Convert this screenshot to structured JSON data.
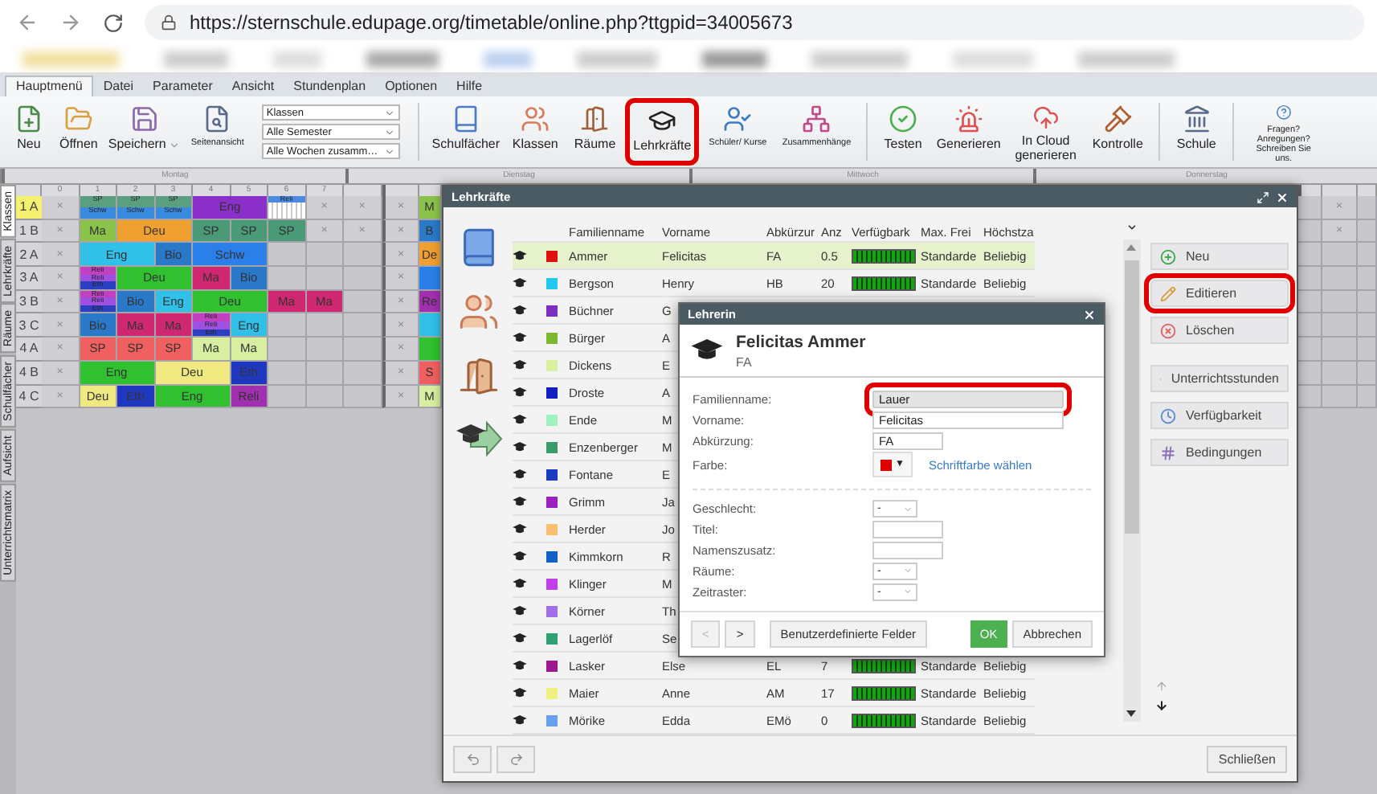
{
  "browser": {
    "url": "https://sternschule.edupage.org/timetable/online.php?ttgpid=34005673"
  },
  "menu_tabs": [
    {
      "label": "Hauptmenü",
      "selected": true
    },
    {
      "label": "Datei",
      "selected": false
    },
    {
      "label": "Parameter",
      "selected": false
    },
    {
      "label": "Ansicht",
      "selected": false
    },
    {
      "label": "Stundenplan",
      "selected": false
    },
    {
      "label": "Optionen",
      "selected": false
    },
    {
      "label": "Hilfe",
      "selected": false
    }
  ],
  "toolbar": [
    {
      "kind": "button",
      "label": "Neu",
      "highlighted": false
    },
    {
      "kind": "button",
      "label": "Öffnen",
      "highlighted": false
    },
    {
      "kind": "split",
      "label": "Speichern",
      "highlighted": false
    },
    {
      "kind": "small",
      "label": "Seitenansicht",
      "highlighted": false
    },
    {
      "kind": "selects",
      "options": [
        {
          "value": "Klassen"
        },
        {
          "value": "Alle Semester"
        },
        {
          "value": "Alle Wochen zusamm…"
        }
      ]
    },
    {
      "kind": "separator"
    },
    {
      "kind": "button",
      "label": "Schulfächer",
      "highlighted": false
    },
    {
      "kind": "button",
      "label": "Klassen",
      "highlighted": false
    },
    {
      "kind": "button",
      "label": "Räume",
      "highlighted": false
    },
    {
      "kind": "button",
      "label": "Lehrkräfte",
      "highlighted": true
    },
    {
      "kind": "small",
      "label": "Schüler/ Kurse",
      "highlighted": false
    },
    {
      "kind": "small",
      "label": "Zusammenhänge",
      "highlighted": false
    },
    {
      "kind": "separator"
    },
    {
      "kind": "button",
      "label": "Testen",
      "highlighted": false
    },
    {
      "kind": "button",
      "label": "Generieren",
      "highlighted": false
    },
    {
      "kind": "button",
      "label": "In Cloud generieren",
      "highlighted": false
    },
    {
      "kind": "button",
      "label": "Kontrolle",
      "highlighted": false
    },
    {
      "kind": "separator"
    },
    {
      "kind": "button",
      "label": "Schule",
      "highlighted": false
    },
    {
      "kind": "separator"
    },
    {
      "kind": "small",
      "label": "Fragen? Anregungen? Schreiben Sie uns.",
      "highlighted": false
    }
  ],
  "side_tabs": [
    {
      "label": "Klassen",
      "selected": true
    },
    {
      "label": "Lehrkräfte",
      "selected": false
    },
    {
      "label": "Räume",
      "selected": false
    },
    {
      "label": "Schulfächer",
      "selected": false
    },
    {
      "label": "Aufsicht",
      "selected": false
    },
    {
      "label": "Unterrichtsmatrix",
      "selected": false
    }
  ],
  "timetable": {
    "days": [
      "Montag",
      "Dienstag",
      "Mittwoch",
      "Donnerstag"
    ],
    "periods": [
      "0",
      "1",
      "2",
      "3",
      "4",
      "5",
      "6",
      "7"
    ],
    "rows": [
      {
        "label": "1 A",
        "selected": true,
        "cells": [
          {
            "kind": "blocked",
            "text": "×"
          },
          {
            "kind": "split",
            "stripes": [
              {
                "text": "SP",
                "color": "#5aa080"
              },
              {
                "text": "Schw",
                "color": "#3a8ae0"
              }
            ]
          },
          {
            "kind": "split",
            "stripes": [
              {
                "text": "SP",
                "color": "#5aa080"
              },
              {
                "text": "Schw",
                "color": "#3a8ae0"
              }
            ]
          },
          {
            "kind": "split",
            "stripes": [
              {
                "text": "SP",
                "color": "#5aa080"
              },
              {
                "text": "Schw",
                "color": "#3a8ae0"
              }
            ]
          },
          {
            "kind": "double",
            "text": "Eng",
            "color": "#8a30c8"
          },
          {
            "kind": "partial",
            "text": "Reli",
            "color": "#4a8ae0"
          },
          {
            "kind": "blocked",
            "text": "×"
          },
          {
            "kind": "blocked",
            "text": "×"
          },
          {
            "kind": "blocked",
            "text": "×"
          },
          {
            "kind": "lesson",
            "text": "M",
            "color": "#8bc34a"
          }
        ],
        "right_cells": [
          {
            "kind": "empty"
          },
          {
            "kind": "blocked",
            "text": "×"
          },
          {
            "kind": "empty"
          }
        ]
      },
      {
        "label": "1 B",
        "selected": false,
        "cells": [
          {
            "kind": "blocked",
            "text": "×"
          },
          {
            "kind": "lesson",
            "text": "Ma",
            "color": "#8bc34a"
          },
          {
            "kind": "double",
            "text": "Deu",
            "color": "#f0a030"
          },
          {
            "kind": "lesson",
            "text": "SP",
            "color": "#4a9a78"
          },
          {
            "kind": "lesson",
            "text": "SP",
            "color": "#4a9a78"
          },
          {
            "kind": "lesson",
            "text": "SP",
            "color": "#4a9a78"
          },
          {
            "kind": "blocked",
            "text": "×"
          },
          {
            "kind": "blocked",
            "text": "×"
          },
          {
            "kind": "blocked",
            "text": "×"
          },
          {
            "kind": "lesson",
            "text": "B",
            "color": "#2a7ac8"
          }
        ],
        "right_cells": [
          {
            "kind": "empty"
          },
          {
            "kind": "blocked",
            "text": "×"
          },
          {
            "kind": "empty"
          }
        ]
      },
      {
        "label": "2 A",
        "selected": false,
        "cells": [
          {
            "kind": "blocked",
            "text": "×"
          },
          {
            "kind": "double",
            "text": "Eng",
            "color": "#30c0e8"
          },
          {
            "kind": "lesson",
            "text": "Bio",
            "color": "#2a78c8"
          },
          {
            "kind": "double",
            "text": "Schw",
            "color": "#2a80e8"
          },
          {
            "kind": "empty"
          },
          {
            "kind": "empty"
          },
          {
            "kind": "empty"
          },
          {
            "kind": "blocked",
            "text": "×"
          },
          {
            "kind": "lesson",
            "text": "De",
            "color": "#f0a030"
          }
        ],
        "right_cells": [
          {
            "kind": "empty"
          },
          {
            "kind": "empty"
          },
          {
            "kind": "empty"
          }
        ]
      },
      {
        "label": "3 A",
        "selected": false,
        "cells": [
          {
            "kind": "blocked",
            "text": "×"
          },
          {
            "kind": "split",
            "stripes": [
              {
                "text": "Reli",
                "color": "#c040c0"
              },
              {
                "text": "Reli",
                "color": "#a050e0"
              },
              {
                "text": "Eth",
                "color": "#2a40c0"
              }
            ]
          },
          {
            "kind": "double",
            "text": "Deu",
            "color": "#30c030"
          },
          {
            "kind": "lesson",
            "text": "Ma",
            "color": "#d02870"
          },
          {
            "kind": "lesson",
            "text": "Bio",
            "color": "#2a78c8"
          },
          {
            "kind": "empty"
          },
          {
            "kind": "empty"
          },
          {
            "kind": "empty"
          },
          {
            "kind": "blocked",
            "text": "×"
          },
          {
            "kind": "lesson",
            "color": "#2a80e8"
          }
        ],
        "right_cells": [
          {
            "kind": "empty"
          },
          {
            "kind": "empty"
          },
          {
            "kind": "empty"
          }
        ]
      },
      {
        "label": "3 B",
        "selected": false,
        "cells": [
          {
            "kind": "blocked",
            "text": "×"
          },
          {
            "kind": "split",
            "stripes": [
              {
                "text": "Reli",
                "color": "#c040c0"
              },
              {
                "text": "Reli",
                "color": "#a050e0"
              },
              {
                "text": "Eth",
                "color": "#2a40c0"
              }
            ]
          },
          {
            "kind": "lesson",
            "text": "Bio",
            "color": "#2a78c8"
          },
          {
            "kind": "lesson",
            "text": "Eng",
            "color": "#30c0e8"
          },
          {
            "kind": "double",
            "text": "Deu",
            "color": "#30c030"
          },
          {
            "kind": "lesson",
            "text": "Ma",
            "color": "#d02870"
          },
          {
            "kind": "lesson",
            "text": "Ma",
            "color": "#d02870"
          },
          {
            "kind": "empty"
          },
          {
            "kind": "blocked",
            "text": "×"
          },
          {
            "kind": "lesson",
            "text": "Re",
            "color": "#a030b0"
          }
        ],
        "right_cells": [
          {
            "kind": "empty"
          },
          {
            "kind": "empty"
          },
          {
            "kind": "empty"
          }
        ]
      },
      {
        "label": "3 C",
        "selected": false,
        "cells": [
          {
            "kind": "blocked",
            "text": "×"
          },
          {
            "kind": "lesson",
            "text": "Bio",
            "color": "#2a78c8"
          },
          {
            "kind": "lesson",
            "text": "Ma",
            "color": "#d02870"
          },
          {
            "kind": "lesson",
            "text": "Ma",
            "color": "#d02870"
          },
          {
            "kind": "split",
            "stripes": [
              {
                "text": "Reli",
                "color": "#c040c0"
              },
              {
                "text": "Reli",
                "color": "#a050e0"
              },
              {
                "text": "Eth",
                "color": "#2a40c0"
              }
            ]
          },
          {
            "kind": "lesson",
            "text": "Eng",
            "color": "#30c0e8"
          },
          {
            "kind": "empty"
          },
          {
            "kind": "empty"
          },
          {
            "kind": "empty"
          },
          {
            "kind": "blocked",
            "text": "×"
          },
          {
            "kind": "lesson",
            "color": "#30c0e8"
          }
        ],
        "right_cells": [
          {
            "kind": "empty"
          },
          {
            "kind": "empty"
          },
          {
            "kind": "empty"
          }
        ]
      },
      {
        "label": "4 A",
        "selected": false,
        "cells": [
          {
            "kind": "blocked",
            "text": "×"
          },
          {
            "kind": "lesson",
            "text": "SP",
            "color": "#f06060"
          },
          {
            "kind": "lesson",
            "text": "SP",
            "color": "#f06060"
          },
          {
            "kind": "lesson",
            "text": "SP",
            "color": "#f06060"
          },
          {
            "kind": "lesson",
            "text": "Ma",
            "color": "#d8eea0"
          },
          {
            "kind": "lesson",
            "text": "Ma",
            "color": "#d8eea0"
          },
          {
            "kind": "empty"
          },
          {
            "kind": "empty"
          },
          {
            "kind": "empty"
          },
          {
            "kind": "blocked",
            "text": "×"
          },
          {
            "kind": "lesson",
            "color": "#30c030"
          }
        ],
        "right_cells": [
          {
            "kind": "empty"
          },
          {
            "kind": "empty"
          },
          {
            "kind": "empty"
          }
        ]
      },
      {
        "label": "4 B",
        "selected": false,
        "cells": [
          {
            "kind": "blocked",
            "text": "×"
          },
          {
            "kind": "double",
            "text": "Eng",
            "color": "#30c030"
          },
          {
            "kind": "double",
            "text": "Deu",
            "color": "#f0e880"
          },
          {
            "kind": "lesson",
            "text": "Eth",
            "color": "#2038c0"
          },
          {
            "kind": "empty"
          },
          {
            "kind": "empty"
          },
          {
            "kind": "empty"
          },
          {
            "kind": "blocked",
            "text": "×"
          },
          {
            "kind": "lesson",
            "text": "S",
            "color": "#f06060"
          }
        ],
        "right_cells": [
          {
            "kind": "empty"
          },
          {
            "kind": "empty"
          },
          {
            "kind": "empty"
          }
        ]
      },
      {
        "label": "4 C",
        "selected": false,
        "cells": [
          {
            "kind": "blocked",
            "text": "×"
          },
          {
            "kind": "lesson",
            "text": "Deu",
            "color": "#f0e880"
          },
          {
            "kind": "lesson",
            "text": "Eth",
            "color": "#2038c0"
          },
          {
            "kind": "double",
            "text": "Eng",
            "color": "#30c030"
          },
          {
            "kind": "lesson",
            "text": "Reli",
            "color": "#a030b0"
          },
          {
            "kind": "empty"
          },
          {
            "kind": "empty"
          },
          {
            "kind": "empty"
          },
          {
            "kind": "blocked",
            "text": "×"
          },
          {
            "kind": "lesson",
            "text": "M",
            "color": "#d8eea0"
          }
        ],
        "right_cells": [
          {
            "kind": "empty"
          },
          {
            "kind": "empty"
          },
          {
            "kind": "empty"
          }
        ]
      }
    ]
  },
  "teachers_window": {
    "title": "Lehrkräfte",
    "columns": [
      "Familienname",
      "Vorname",
      "Abkürzur",
      "Anz",
      "Verfügbark",
      "Max. Frei",
      "Höchstza"
    ],
    "rows": [
      {
        "surname": "Ammer",
        "first_name": "Felicitas",
        "abbr": "FA",
        "count": "0.5",
        "max_free": "Standarde",
        "max": "Beliebig",
        "color": "#e01010",
        "selected": true
      },
      {
        "surname": "Bergson",
        "first_name": "Henry",
        "abbr": "HB",
        "count": "20",
        "max_free": "Standarde",
        "max": "Beliebig",
        "color": "#20c8f0",
        "selected": false
      },
      {
        "surname": "Büchner",
        "first_name": "G",
        "color": "#7a2fc0",
        "selected": false
      },
      {
        "surname": "Bürger",
        "first_name": "A",
        "color": "#7cb82f",
        "selected": false
      },
      {
        "surname": "Dickens",
        "first_name": "E",
        "color": "#d8f0a0",
        "selected": false
      },
      {
        "surname": "Droste",
        "first_name": "A",
        "color": "#1020c0",
        "selected": false
      },
      {
        "surname": "Ende",
        "first_name": "M",
        "color": "#a0f0c0",
        "selected": false
      },
      {
        "surname": "Enzenberger",
        "first_name": "M",
        "color": "#3a9a6a",
        "selected": false
      },
      {
        "surname": "Fontane",
        "first_name": "E",
        "color": "#1a3ac0",
        "selected": false
      },
      {
        "surname": "Grimm",
        "first_name": "Ja",
        "color": "#9a20c0",
        "selected": false
      },
      {
        "surname": "Herder",
        "first_name": "Jo",
        "color": "#f8c070",
        "selected": false
      },
      {
        "surname": "Kimmkorn",
        "first_name": "R",
        "color": "#1060c8",
        "selected": false
      },
      {
        "surname": "Klinger",
        "first_name": "M",
        "color": "#c040e8",
        "selected": false
      },
      {
        "surname": "Körner",
        "first_name": "Th",
        "color": "#a070e8",
        "selected": false
      },
      {
        "surname": "Lagerlöf",
        "first_name": "Se",
        "color": "#30a070",
        "selected": false
      },
      {
        "surname": "Lasker",
        "first_name": "Else",
        "abbr": "EL",
        "count": "7",
        "max_free": "Standarde",
        "max": "Beliebig",
        "color": "#a01890",
        "selected": false
      },
      {
        "surname": "Maier",
        "first_name": "Anne",
        "abbr": "AM",
        "count": "17",
        "max_free": "Standarde",
        "max": "Beliebig",
        "color": "#f0f080",
        "selected": false
      },
      {
        "surname": "Mörike",
        "first_name": "Edda",
        "abbr": "EMö",
        "count": "0",
        "max_free": "Standarde",
        "max": "Beliebig",
        "color": "#6aa0f0",
        "selected": false
      }
    ],
    "actions": [
      {
        "label": "Neu",
        "highlighted": false
      },
      {
        "label": "Editieren",
        "highlighted": true
      },
      {
        "label": "Löschen",
        "highlighted": false
      }
    ],
    "view_actions": [
      {
        "label": "Unterrichtsstunden",
        "highlighted": false
      },
      {
        "label": "Verfügbarkeit",
        "highlighted": false
      },
      {
        "label": "Bedingungen",
        "highlighted": false
      }
    ],
    "close_button": "Schließen"
  },
  "teacher_dialog": {
    "title": "Lehrerin",
    "name": "Felicitas Ammer",
    "abbr": "FA",
    "fields": [
      {
        "kind": "text",
        "label": "Familienname:",
        "value": "Lauer",
        "focused": true,
        "highlighted": true,
        "separated": false
      },
      {
        "kind": "text",
        "label": "Vorname:",
        "value": "Felicitas",
        "focused": false,
        "highlighted": false,
        "separated": false
      },
      {
        "kind": "short",
        "label": "Abkürzung:",
        "value": "FA",
        "focused": false,
        "highlighted": false,
        "separated": false
      },
      {
        "kind": "color",
        "label": "Farbe:",
        "color": "#e00000",
        "caret": "▼",
        "link": "Schriftfarbe wählen",
        "separated": false
      },
      {
        "kind": "select",
        "label": "Geschlecht:",
        "value": "-",
        "separated": true
      },
      {
        "kind": "short",
        "label": "Titel:",
        "focused": false,
        "highlighted": false,
        "separated": false
      },
      {
        "kind": "short",
        "label": "Namenszusatz:",
        "focused": false,
        "highlighted": false,
        "separated": false
      },
      {
        "kind": "select",
        "label": "Räume:",
        "value": "-",
        "separated": false
      },
      {
        "kind": "select",
        "label": "Zeitraster:",
        "value": "-",
        "separated": false
      }
    ],
    "prev": {
      "label": "<",
      "disabled": true
    },
    "next": {
      "label": ">",
      "disabled": false
    },
    "custom_button": "Benutzerdefinierte Felder",
    "ok_button": "OK",
    "cancel_button": "Abbrechen"
  }
}
